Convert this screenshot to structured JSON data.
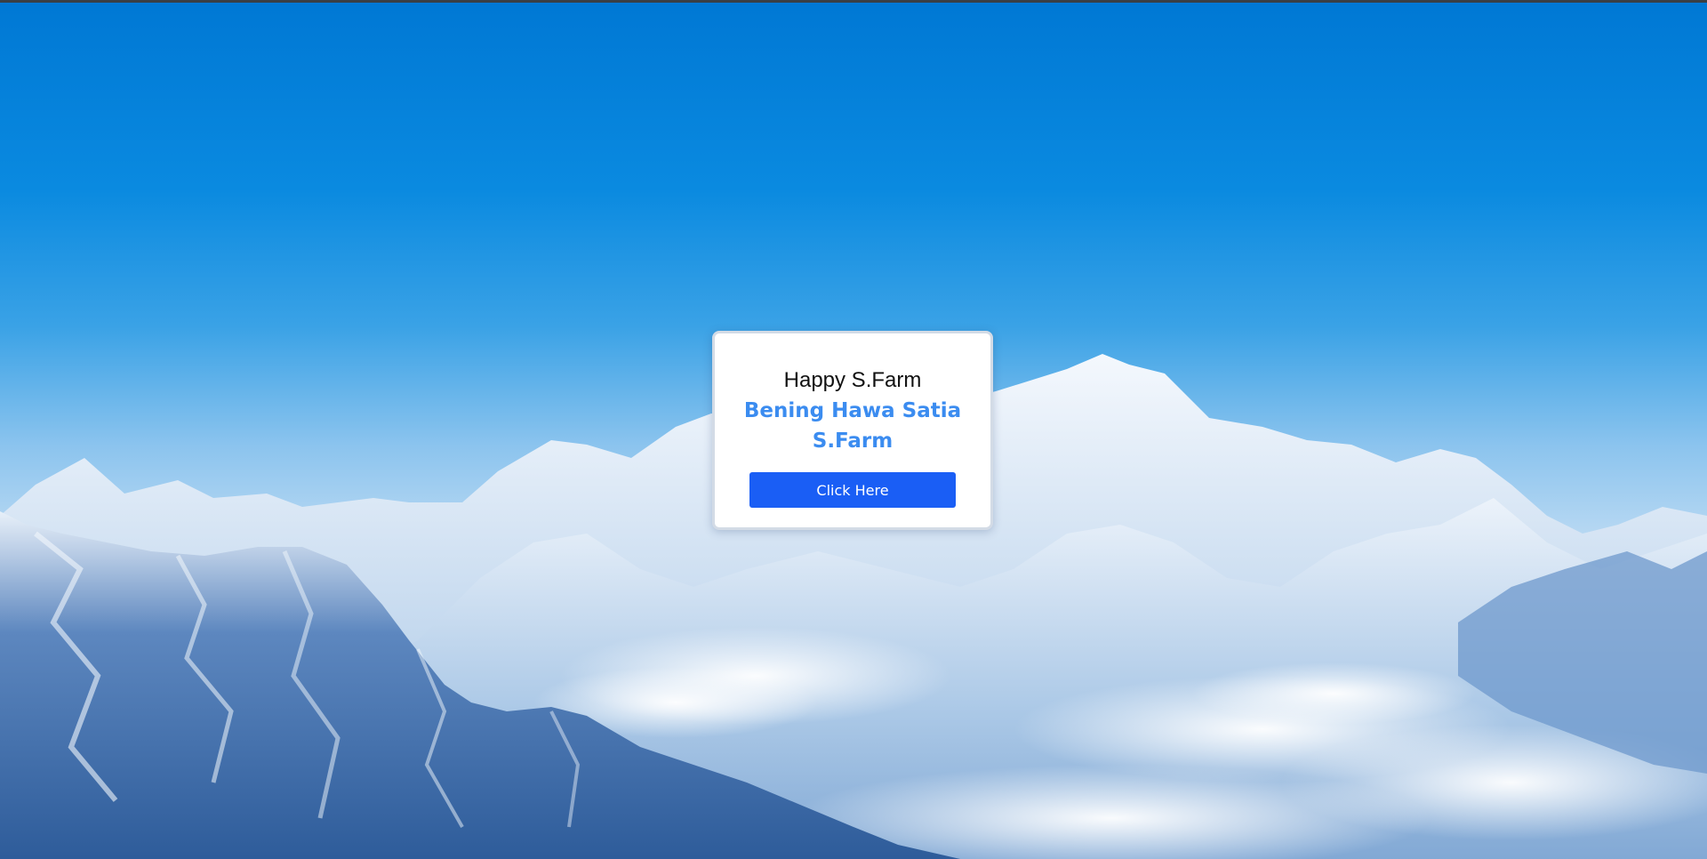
{
  "card": {
    "title": "Happy S.Farm",
    "subtitle": "Bening Hawa Satia S.Farm",
    "button_label": "Click Here"
  },
  "colors": {
    "sky_top": "#0078d4",
    "subtitle_blue": "#3b8cf0",
    "button_blue": "#1a5ef5"
  }
}
